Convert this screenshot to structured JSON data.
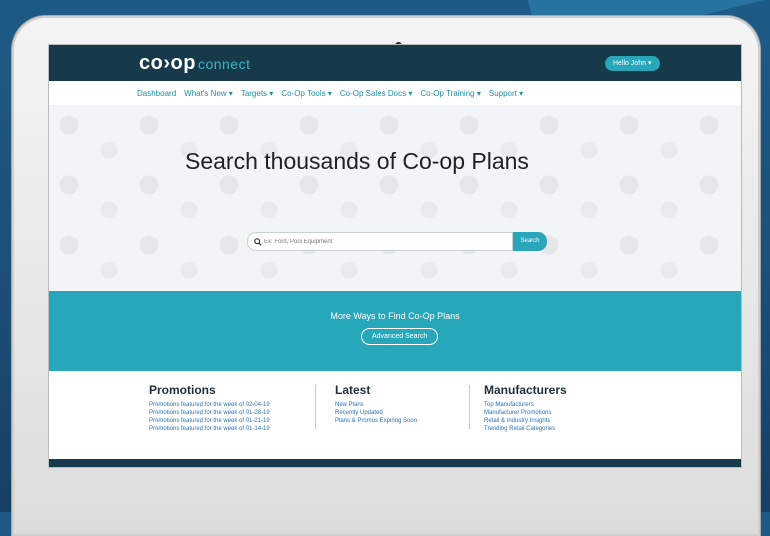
{
  "header": {
    "logo_main": "co›op",
    "logo_sub": "connect",
    "user_menu": "Hello John ▾"
  },
  "nav": {
    "items": [
      "Dashboard",
      "What's New ▾",
      "Targets ▾",
      "Co-Op Tools ▾",
      "Co-Op Sales Docs ▾",
      "Co-Op Training ▾",
      "Support ▾"
    ]
  },
  "hero": {
    "title": "Search thousands of Co-op Plans",
    "search_placeholder": "Ex: Ford, Pool Equipment",
    "search_button": "Search"
  },
  "band": {
    "title": "More Ways to Find Co-Op Plans",
    "advanced_button": "Advanced Search"
  },
  "promotions": {
    "title": "Promotions",
    "links": [
      "Promotions featured for the week of 02-04-19",
      "Promotions featured for the week of 01-28-19",
      "Promotions featured for the week of 01-21-19",
      "Promotions featured for the week of 01-14-19"
    ]
  },
  "latest": {
    "title": "Latest",
    "links": [
      "New Plans",
      "Recently Updated",
      "Plans & Promos Expiring Soon"
    ]
  },
  "manufacturers": {
    "title": "Manufacturers",
    "links": [
      "Top Manufacturers",
      "Manufacturer Promotions",
      "Retail & Industry Insights",
      "Trending Retail Categories"
    ]
  },
  "colors": {
    "navy": "#173a4b",
    "teal": "#26a7ba",
    "link": "#2a73b7"
  }
}
